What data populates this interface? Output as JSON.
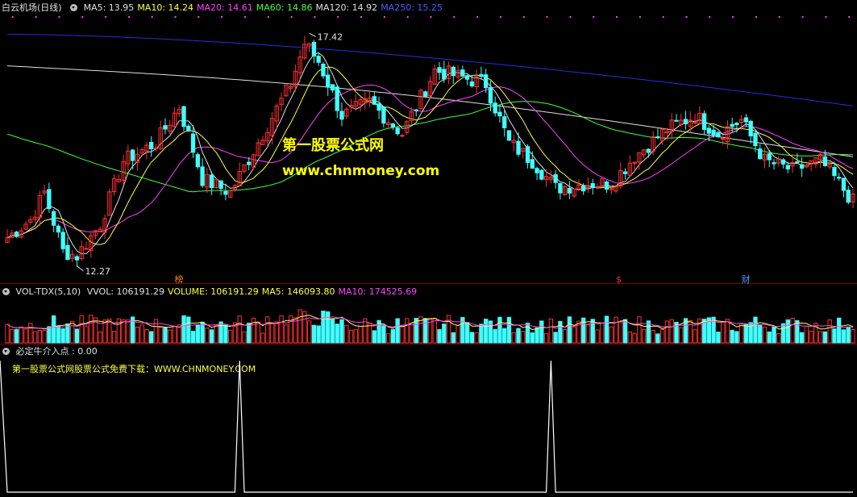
{
  "main_panel": {
    "title": "白云机场(日线)",
    "indicators": [
      {
        "label": "MA5: 13.95",
        "color": "#e0e0e0"
      },
      {
        "label": "MA10: 14.24",
        "color": "#ffff40"
      },
      {
        "label": "MA20: 14.61",
        "color": "#ff40ff"
      },
      {
        "label": "MA60: 14.86",
        "color": "#40ff40"
      },
      {
        "label": "MA120: 14.92",
        "color": "#e0e0e0"
      },
      {
        "label": "MA250: 15.25",
        "color": "#4060ff"
      }
    ],
    "high_label": "17.42",
    "low_label": "12.27",
    "markers": [
      {
        "text": "榜",
        "color": "#ff8000"
      },
      {
        "text": "$",
        "color": "#ff3030"
      },
      {
        "text": "财",
        "color": "#40a0ff"
      }
    ]
  },
  "watermark": {
    "line1": "第一股票公式网",
    "line2": "www.chnmoney.com"
  },
  "volume_panel": {
    "title": "VOL-TDX(5,10)",
    "indicators": [
      {
        "label": "VVOL: 106191.29",
        "color": "#e0e0e0"
      },
      {
        "label": "VOLUME: 106191.29",
        "color": "#ffff40"
      },
      {
        "label": "MA5: 146093.80",
        "color": "#ffff40"
      },
      {
        "label": "MA10: 174525.69",
        "color": "#ff40ff"
      }
    ]
  },
  "signal_panel": {
    "title": "必定牛介入点 : 0.00",
    "note": "第一股票公式网股票公式免费下载：WWW.CHNMONEY.COM"
  },
  "colors": {
    "up": "#ff3030",
    "down": "#40ffff",
    "ma5": "#e0e0e0",
    "ma10": "#ffff40",
    "ma20": "#ff40ff",
    "ma60": "#40ff40",
    "ma120": "#e0e0e0",
    "ma250": "#2030e0",
    "separator": "#7a0000"
  },
  "chart_data": {
    "type": "candlestick",
    "price_range": [
      12.0,
      17.8
    ],
    "high": 17.42,
    "low": 12.27,
    "anchors": [
      [
        0,
        12.9
      ],
      [
        5,
        13.3
      ],
      [
        8,
        13.9
      ],
      [
        12,
        12.6
      ],
      [
        15,
        12.5
      ],
      [
        20,
        13.2
      ],
      [
        25,
        14.6
      ],
      [
        32,
        15.0
      ],
      [
        37,
        15.8
      ],
      [
        42,
        14.2
      ],
      [
        48,
        13.9
      ],
      [
        55,
        15.2
      ],
      [
        61,
        16.3
      ],
      [
        64,
        17.2
      ],
      [
        67,
        16.8
      ],
      [
        72,
        15.6
      ],
      [
        78,
        15.9
      ],
      [
        85,
        15.2
      ],
      [
        92,
        16.6
      ],
      [
        96,
        16.5
      ],
      [
        103,
        16.3
      ],
      [
        108,
        15.0
      ],
      [
        113,
        14.6
      ],
      [
        118,
        14.0
      ],
      [
        125,
        14.1
      ],
      [
        130,
        14.1
      ],
      [
        135,
        14.7
      ],
      [
        142,
        15.3
      ],
      [
        148,
        15.6
      ],
      [
        153,
        15.2
      ],
      [
        158,
        15.5
      ],
      [
        163,
        14.6
      ],
      [
        169,
        14.4
      ],
      [
        175,
        14.6
      ],
      [
        179,
        14.1
      ],
      [
        182,
        13.7
      ]
    ],
    "n_bars": 183,
    "volume_scale": [
      0,
      300000
    ],
    "signal_spikes": [
      50,
      117
    ]
  }
}
